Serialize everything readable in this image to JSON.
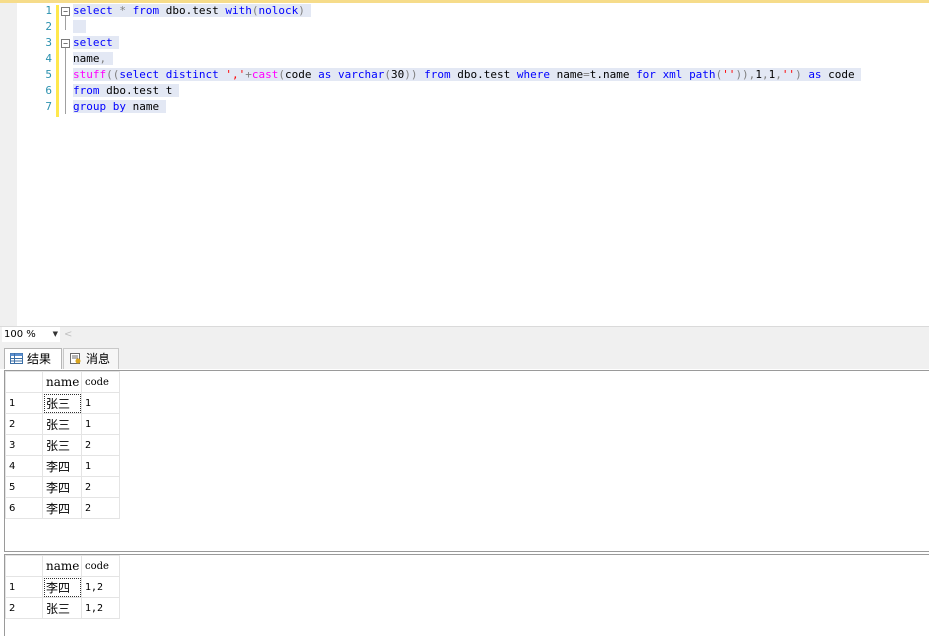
{
  "editor": {
    "line_numbers": [
      "1",
      "2",
      "3",
      "4",
      "5",
      "6",
      "7"
    ],
    "lines": [
      [
        {
          "t": "select",
          "c": "kw"
        },
        {
          "t": " "
        },
        {
          "t": "*",
          "c": "op"
        },
        {
          "t": " "
        },
        {
          "t": "from",
          "c": "kw"
        },
        {
          "t": " dbo.test "
        },
        {
          "t": "with",
          "c": "kw"
        },
        {
          "t": "(",
          "c": "op"
        },
        {
          "t": "nolock",
          "c": "kw"
        },
        {
          "t": ")",
          "c": "op"
        }
      ],
      [],
      [
        {
          "t": "select",
          "c": "kw"
        }
      ],
      [
        {
          "t": "name"
        },
        {
          "t": ",",
          "c": "op"
        }
      ],
      [
        {
          "t": "stuff",
          "c": "fn"
        },
        {
          "t": "((",
          "c": "op"
        },
        {
          "t": "select",
          "c": "kw"
        },
        {
          "t": " "
        },
        {
          "t": "distinct",
          "c": "kw"
        },
        {
          "t": " "
        },
        {
          "t": "','",
          "c": "str"
        },
        {
          "t": "+",
          "c": "op"
        },
        {
          "t": "cast",
          "c": "fn"
        },
        {
          "t": "(",
          "c": "op"
        },
        {
          "t": "code "
        },
        {
          "t": "as",
          "c": "kw"
        },
        {
          "t": " "
        },
        {
          "t": "varchar",
          "c": "kw"
        },
        {
          "t": "(",
          "c": "op"
        },
        {
          "t": "30"
        },
        {
          "t": "))",
          "c": "op"
        },
        {
          "t": " "
        },
        {
          "t": "from",
          "c": "kw"
        },
        {
          "t": " dbo.test "
        },
        {
          "t": "where",
          "c": "kw"
        },
        {
          "t": " name"
        },
        {
          "t": "=",
          "c": "op"
        },
        {
          "t": "t.name "
        },
        {
          "t": "for",
          "c": "kw"
        },
        {
          "t": " "
        },
        {
          "t": "xml",
          "c": "kw"
        },
        {
          "t": " "
        },
        {
          "t": "path",
          "c": "kw"
        },
        {
          "t": "(",
          "c": "op"
        },
        {
          "t": "''",
          "c": "str"
        },
        {
          "t": ")),",
          "c": "op"
        },
        {
          "t": "1"
        },
        {
          "t": ",",
          "c": "op"
        },
        {
          "t": "1"
        },
        {
          "t": ",",
          "c": "op"
        },
        {
          "t": "''",
          "c": "str"
        },
        {
          "t": ")",
          "c": "op"
        },
        {
          "t": " "
        },
        {
          "t": "as",
          "c": "kw"
        },
        {
          "t": " code"
        }
      ],
      [
        {
          "t": "from",
          "c": "kw"
        },
        {
          "t": " dbo.test t"
        }
      ],
      [
        {
          "t": "group",
          "c": "kw"
        },
        {
          "t": " "
        },
        {
          "t": "by",
          "c": "kw"
        },
        {
          "t": " name"
        }
      ]
    ]
  },
  "zoom": {
    "value": "100 %",
    "arrow": "▼",
    "scroll_left": "<"
  },
  "tabs": {
    "results": "结果",
    "messages": "消息"
  },
  "result1": {
    "columns": [
      "name",
      "code"
    ],
    "rows": [
      [
        "1",
        "张三",
        "1"
      ],
      [
        "2",
        "张三",
        "1"
      ],
      [
        "3",
        "张三",
        "2"
      ],
      [
        "4",
        "李四",
        "1"
      ],
      [
        "5",
        "李四",
        "2"
      ],
      [
        "6",
        "李四",
        "2"
      ]
    ]
  },
  "result2": {
    "columns": [
      "name",
      "code"
    ],
    "rows": [
      [
        "1",
        "李四",
        "1,2"
      ],
      [
        "2",
        "张三",
        "1,2"
      ]
    ]
  },
  "colors": {
    "keyword": "#0000ff",
    "function": "#ff00ff",
    "string": "#ff0000",
    "operator": "#808080",
    "line_number": "#2b91af",
    "change_bar": "#ffe84d"
  }
}
